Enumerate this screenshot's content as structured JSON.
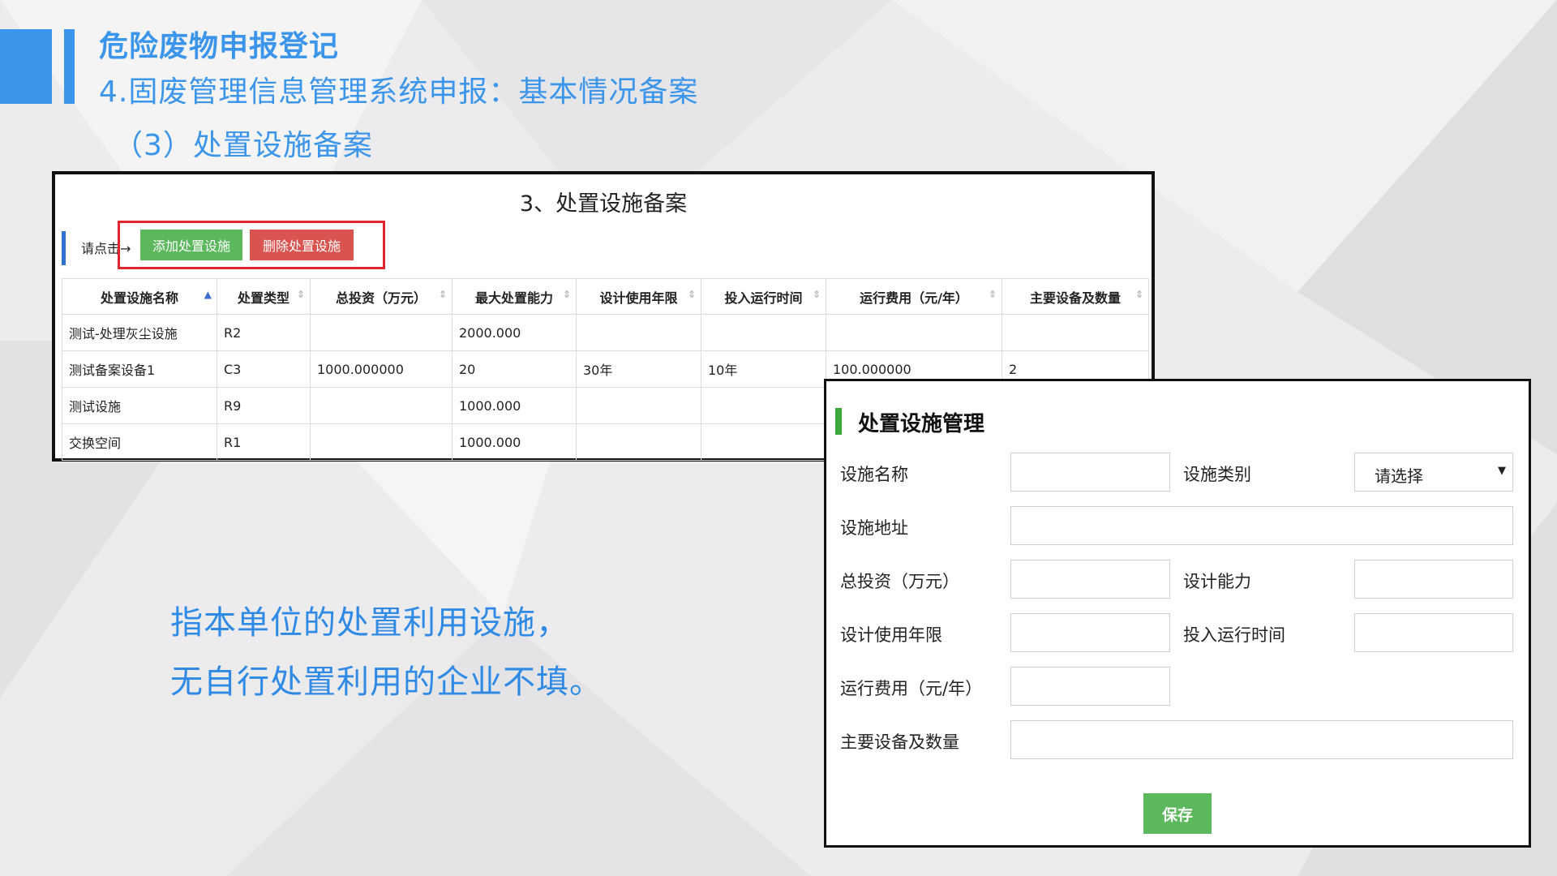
{
  "slide": {
    "title": "危险废物申报登记",
    "subtitle": "4.固废管理信息管理系统申报：基本情况备案",
    "step": "（3）处置设施备案",
    "description_line1": "指本单位的处置利用设施，",
    "description_line2": "无自行处置利用的企业不填。",
    "accent_color": "#3b95ea"
  },
  "table_panel": {
    "heading": "3、处置设施备案",
    "hint": "请点击→",
    "add_button": "添加处置设施",
    "delete_button": "删除处置设施",
    "columns": [
      "处置设施名称",
      "处置类型",
      "总投资（万元）",
      "最大处置能力",
      "设计使用年限",
      "投入运行时间",
      "运行费用（元/年）",
      "主要设备及数量"
    ],
    "rows": [
      [
        "测试-处理灰尘设施",
        "R2",
        "",
        "2000.000",
        "",
        "",
        "",
        ""
      ],
      [
        "测试备案设备1",
        "C3",
        "1000.000000",
        "20",
        "30年",
        "10年",
        "100.000000",
        "2"
      ],
      [
        "测试设施",
        "R9",
        "",
        "1000.000",
        "",
        "",
        "",
        ""
      ],
      [
        "交换空间",
        "R1",
        "",
        "1000.000",
        "",
        "",
        "",
        ""
      ]
    ]
  },
  "form_panel": {
    "title": "处置设施管理",
    "labels": {
      "name": "设施名称",
      "category": "设施类别",
      "address": "设施地址",
      "investment": "总投资（万元）",
      "capacity": "设计能力",
      "service_life": "设计使用年限",
      "operation_time": "投入运行时间",
      "operating_cost": "运行费用（元/年）",
      "equipment": "主要设备及数量"
    },
    "category_select_value": "请选择",
    "save_button": "保存",
    "save_color": "#5cb85c"
  }
}
